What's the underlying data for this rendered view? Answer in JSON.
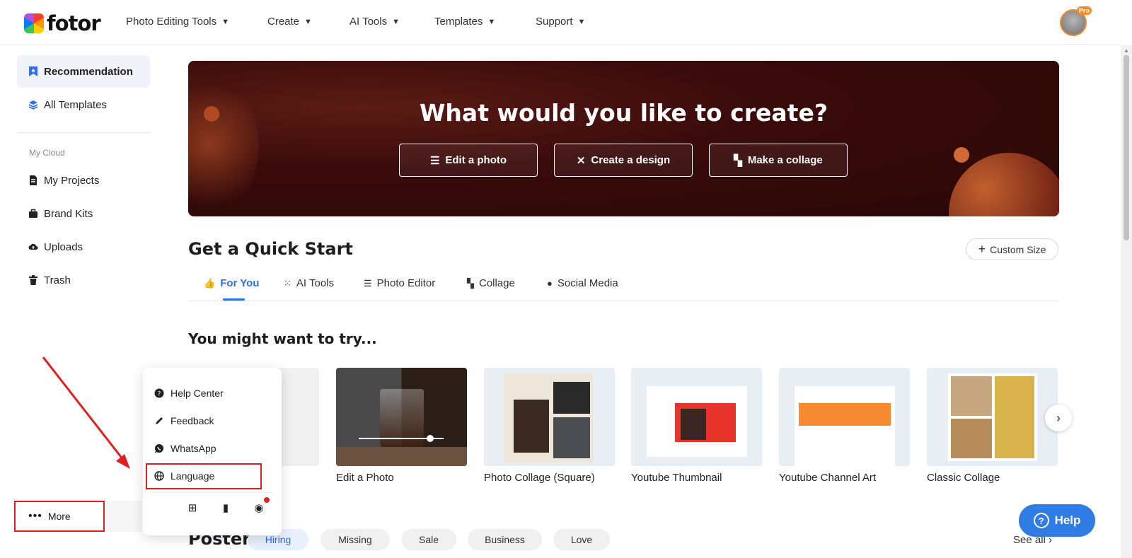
{
  "brand": {
    "name": "fotor"
  },
  "nav": {
    "items": [
      {
        "label": "Photo Editing Tools"
      },
      {
        "label": "Create"
      },
      {
        "label": "AI Tools"
      },
      {
        "label": "Templates"
      },
      {
        "label": "Support"
      }
    ],
    "pro_badge": "Pro"
  },
  "sidebar": {
    "items": [
      {
        "label": "Recommendation",
        "icon": "bookmark-icon"
      },
      {
        "label": "All Templates",
        "icon": "layers-icon"
      }
    ],
    "section_label": "My Cloud",
    "cloud_items": [
      {
        "label": "My Projects",
        "icon": "document-icon"
      },
      {
        "label": "Brand Kits",
        "icon": "briefcase-icon"
      },
      {
        "label": "Uploads",
        "icon": "cloud-upload-icon"
      },
      {
        "label": "Trash",
        "icon": "trash-icon"
      }
    ],
    "more_label": "More"
  },
  "hero": {
    "title": "What would you like to create?",
    "buttons": [
      {
        "label": "Edit a photo",
        "icon": "sliders-icon"
      },
      {
        "label": "Create a design",
        "icon": "magic-wand-icon"
      },
      {
        "label": "Make a collage",
        "icon": "collage-icon"
      }
    ]
  },
  "quick_start": {
    "title": "Get a Quick Start",
    "custom_size": "Custom Size",
    "tabs": [
      {
        "label": "For You",
        "active": true
      },
      {
        "label": "AI Tools"
      },
      {
        "label": "Photo Editor"
      },
      {
        "label": "Collage"
      },
      {
        "label": "Social Media"
      }
    ]
  },
  "try_section": {
    "title": "You might want to try...",
    "cards": [
      {
        "label": ""
      },
      {
        "label": "Edit a Photo"
      },
      {
        "label": "Photo Collage (Square)"
      },
      {
        "label": "Youtube Thumbnail"
      },
      {
        "label": "Youtube Channel Art"
      },
      {
        "label": "Classic Collage"
      }
    ]
  },
  "poster": {
    "title": "Poster",
    "chips": [
      "Hiring",
      "Missing",
      "Sale",
      "Business",
      "Love"
    ],
    "see_all": "See all"
  },
  "more_menu": {
    "items": [
      {
        "label": "Help Center",
        "icon": "question-circle-icon"
      },
      {
        "label": "Feedback",
        "icon": "pencil-icon"
      },
      {
        "label": "WhatsApp",
        "icon": "whatsapp-icon"
      },
      {
        "label": "Language",
        "icon": "globe-icon"
      }
    ],
    "platforms": [
      "apple-icon",
      "windows-icon",
      "mobile-icon",
      "chrome-icon"
    ]
  },
  "help_button": {
    "label": "Help"
  },
  "colors": {
    "accent": "#2f6fec",
    "highlight_red": "#e02020",
    "hero_bg": "#3a0b0b"
  }
}
